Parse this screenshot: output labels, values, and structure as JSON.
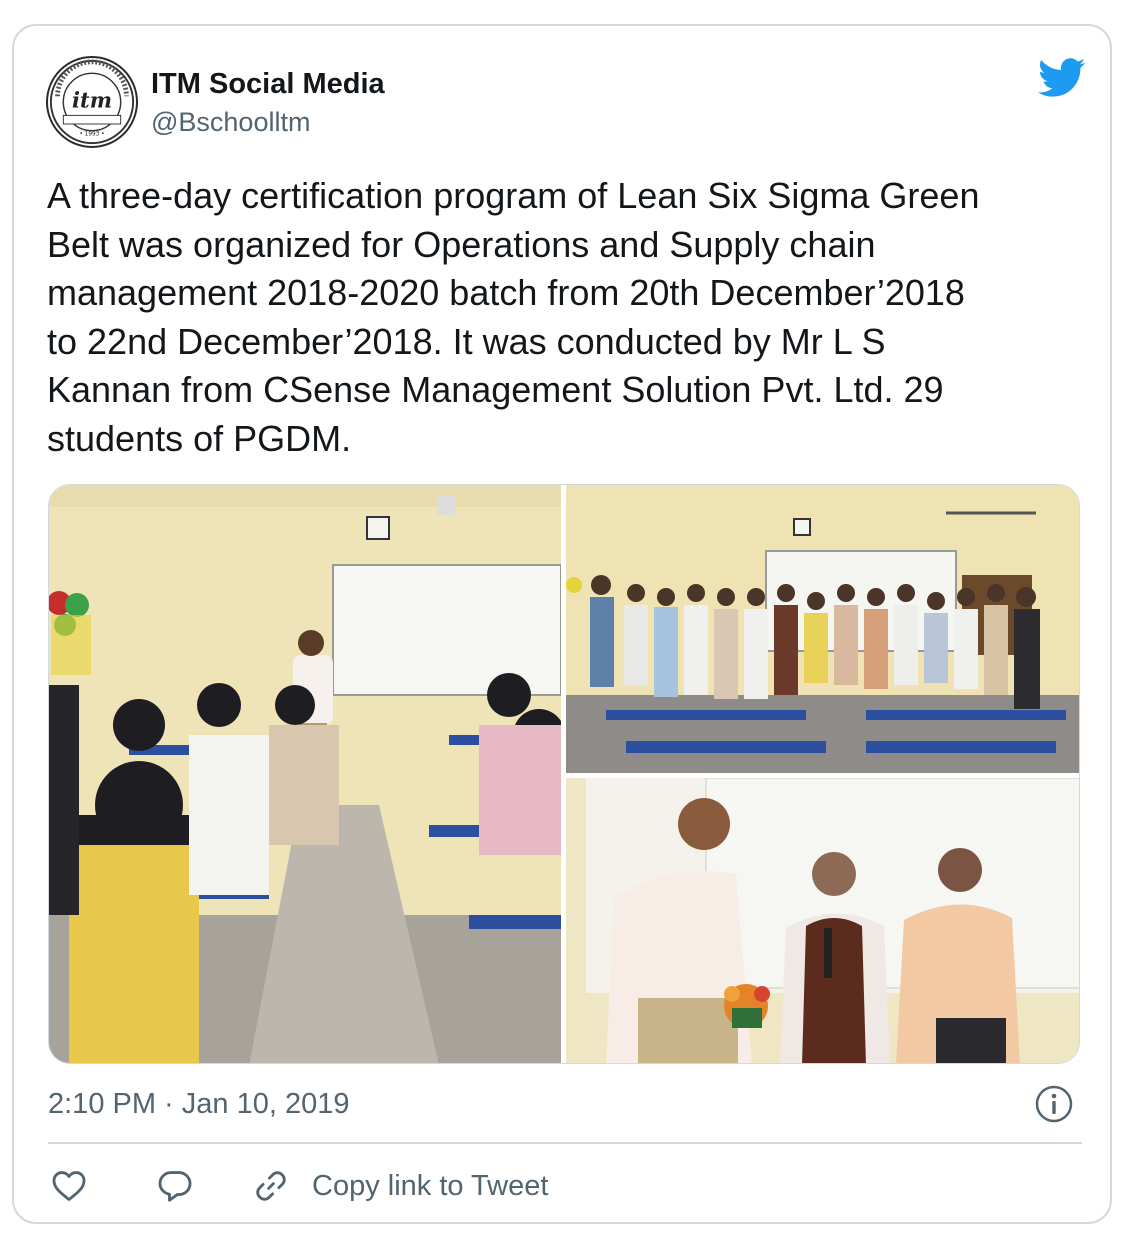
{
  "tweet": {
    "display_name": "ITM Social Media",
    "handle": "@Bschoolltm",
    "text": "A three-day certification program of Lean Six Sigma Green\nBelt was organized for Operations and Supply chain\nmanagement 2018-2020 batch from 20th December’2018\nto 22nd December’2018. It was conducted by Mr L S\nKannan from CSense Management Solution Pvt. Ltd. 29\nstudents of PGDM.",
    "timestamp": "2:10 PM · Jan 10, 2019",
    "avatar_logo": {
      "monogram": "itm",
      "ring_text_top": "INSTITUTE FOR TECHNOLOGY AND MANAGEMENT",
      "ring_text_bottom": "INFORMATION IS LIFE",
      "year": "• 1993 •"
    }
  },
  "actions": {
    "copy_link_label": "Copy link to Tweet"
  },
  "icons": {
    "brand": "twitter-bird-icon",
    "info": "info-icon",
    "like": "heart-icon",
    "reply": "reply-bubble-icon",
    "copy": "link-icon"
  },
  "colors": {
    "brand_blue": "#1d9bf0",
    "text_primary": "#14171a",
    "text_secondary": "#536471",
    "border": "#cfd9de"
  }
}
